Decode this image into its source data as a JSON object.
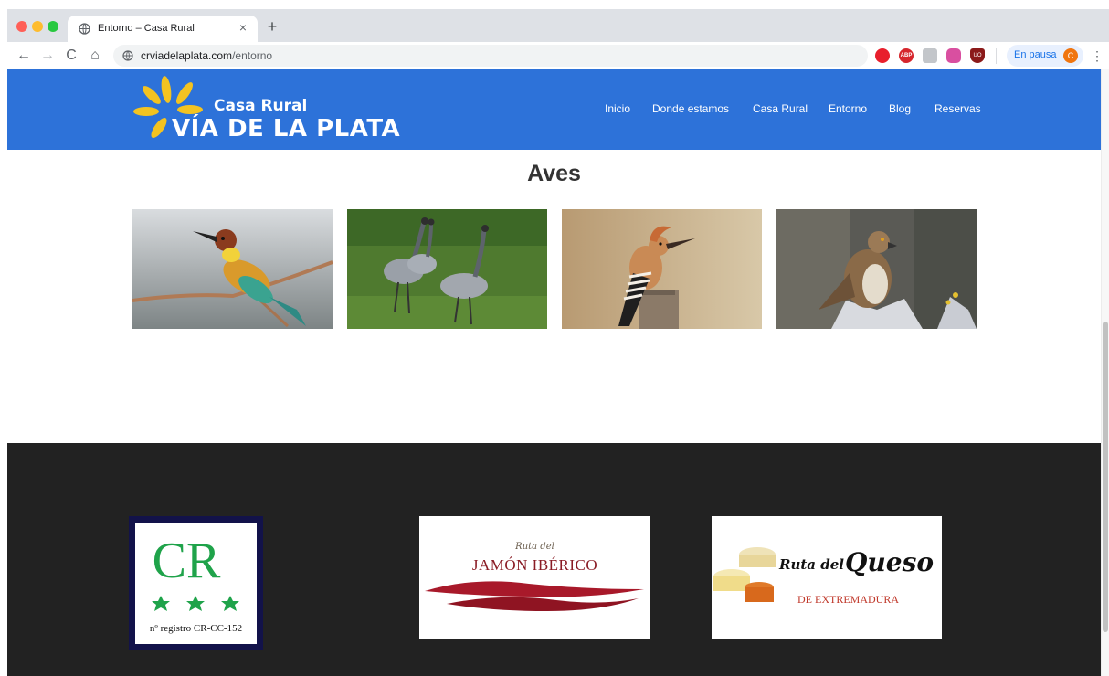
{
  "browser": {
    "tab_title": "Entorno – Casa Rural",
    "tab_close": "×",
    "new_tab": "+",
    "url_host": "crviadelaplata.com",
    "url_path": "/entorno",
    "profile_label": "En pausa",
    "profile_initial": "C",
    "abp_label": "ABP",
    "ublock_label": "UO",
    "menu": "⋮",
    "nav_back": "←",
    "nav_forward": "→",
    "nav_reload": "C",
    "nav_home": "⌂"
  },
  "site": {
    "logo_line1": "Casa Rural",
    "logo_line2": "VÍA DE LA PLATA",
    "nav": {
      "inicio": "Inicio",
      "donde": "Donde estamos",
      "casa": "Casa Rural",
      "entorno": "Entorno",
      "blog": "Blog",
      "reservas": "Reservas"
    },
    "colors": {
      "header": "#2d72d9",
      "footer": "#222222",
      "logo_accent": "#f3c321"
    }
  },
  "section": {
    "title": "Aves",
    "photos": [
      {
        "icon": "bee-eater-photo"
      },
      {
        "icon": "cranes-photo"
      },
      {
        "icon": "hoopoe-photo"
      },
      {
        "icon": "eagle-photo"
      }
    ]
  },
  "footer": {
    "cr_badge": {
      "letters": "CR",
      "registry": "nº registro CR-CC-152"
    },
    "jamon_badge": {
      "small": "Ruta del",
      "big": "JAMÓN IBÉRICO"
    },
    "queso_badge": {
      "script": "Ruta del",
      "big": "Queso",
      "sub": "DE EXTREMADURA"
    }
  }
}
